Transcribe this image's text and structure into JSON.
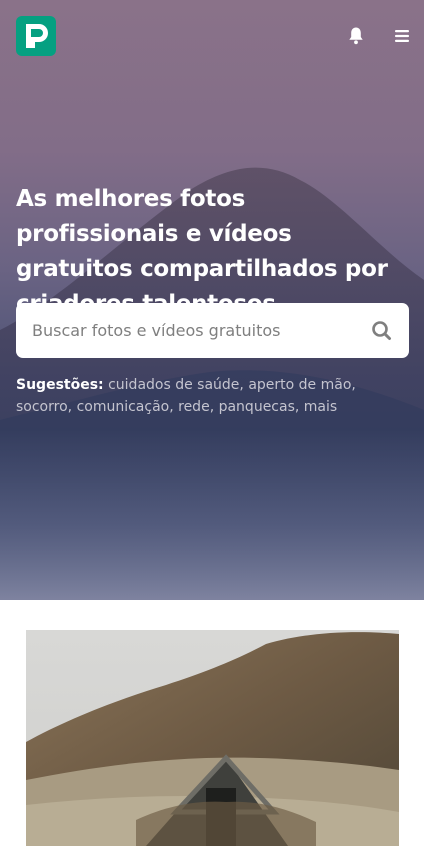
{
  "header": {
    "logo_icon": "pexels-logo-icon",
    "notification_icon": "bell-icon",
    "menu_icon": "hamburger-menu-icon",
    "brand_color": "#05A081"
  },
  "hero": {
    "headline": "As melhores fotos profissionais e vídeos gratuitos compartilhados por criadores talentosos.",
    "search": {
      "placeholder": "Buscar fotos e vídeos gratuitos",
      "value": "",
      "icon": "search-icon"
    },
    "suggestions": {
      "label": "Sugestões:",
      "items": [
        "cuidados de saúde",
        "aperto de mão",
        "socorro",
        "comunicação",
        "rede",
        "panquecas",
        "mais"
      ]
    }
  },
  "gallery": {
    "first_photo_icon": "photo-a-frame-cabin-icon"
  }
}
